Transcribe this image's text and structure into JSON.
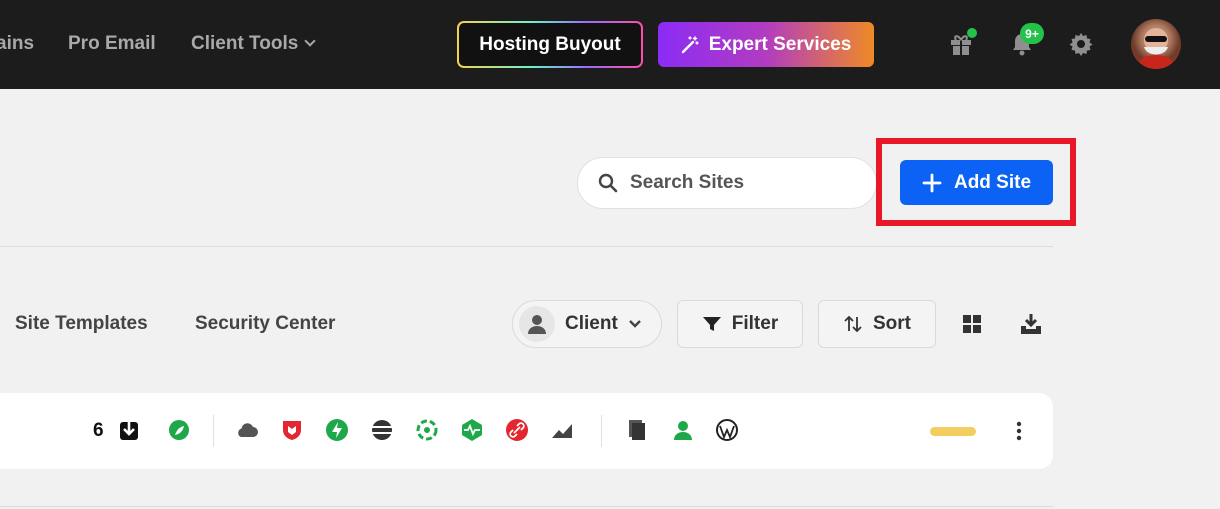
{
  "topbar": {
    "nav": [
      "ains",
      "Pro Email",
      "Client Tools"
    ],
    "hosting_buyout": "Hosting Buyout",
    "expert_services": "Expert Services",
    "notification_count": "9+"
  },
  "header": {
    "search_placeholder": "Search Sites",
    "add_site": "Add Site"
  },
  "tabs": [
    "Site Templates",
    "Security Center"
  ],
  "toolbar": {
    "client": "Client",
    "filter": "Filter",
    "sort": "Sort"
  },
  "site_row": {
    "count": "6",
    "icons": [
      "download-icon",
      "leaf-icon",
      "cloud-icon",
      "shield-icon",
      "bolt-icon",
      "database-icon",
      "atom-icon",
      "pulse-icon",
      "link-icon",
      "chart-icon",
      "pages-icon",
      "user-icon",
      "wordpress-icon"
    ]
  },
  "colors": {
    "accent": "#0b62f4",
    "highlight": "#e8182a",
    "green": "#25c24a",
    "status": "#f2cd5f"
  }
}
